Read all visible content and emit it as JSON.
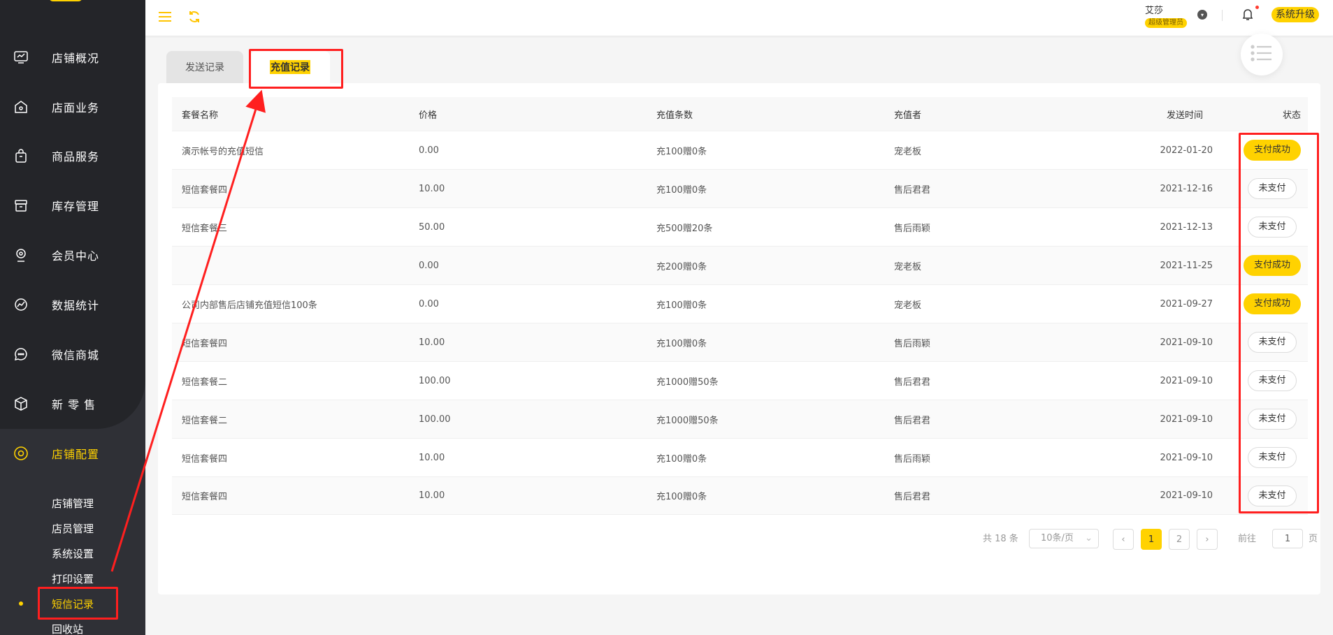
{
  "sidebar": {
    "menu": [
      {
        "label": "店铺概况",
        "icon": "monitor-icon"
      },
      {
        "label": "店面业务",
        "icon": "shop-icon"
      },
      {
        "label": "商品服务",
        "icon": "bag-icon"
      },
      {
        "label": "库存管理",
        "icon": "inventory-box-icon"
      },
      {
        "label": "会员中心",
        "icon": "member-icon"
      },
      {
        "label": "数据统计",
        "icon": "chart-trend-icon"
      },
      {
        "label": "微信商城",
        "icon": "chat-bubble-icon"
      },
      {
        "label": "新 零 售",
        "icon": "cube-icon"
      },
      {
        "label": "店铺配置",
        "icon": "settings-circle-icon"
      }
    ],
    "submenu": [
      "店铺管理",
      "店员管理",
      "系统设置",
      "打印设置",
      "短信记录",
      "回收站"
    ]
  },
  "header": {
    "user_name": "艾莎",
    "user_role": "超级管理员",
    "upgrade_label": "系统升级"
  },
  "tabs": {
    "send": "发送记录",
    "recharge": "充值记录"
  },
  "table": {
    "headers": [
      "套餐名称",
      "价格",
      "充值条数",
      "充值者",
      "发送时间",
      "状态"
    ],
    "rows": [
      {
        "name": "演示帐号的充值短信",
        "price": "0.00",
        "count": "充100赠0条",
        "user": "宠老板",
        "time": "2022-01-20",
        "status": "支付成功",
        "paid": true
      },
      {
        "name": "短信套餐四",
        "price": "10.00",
        "count": "充100赠0条",
        "user": "售后君君",
        "time": "2021-12-16",
        "status": "未支付",
        "paid": false
      },
      {
        "name": "短信套餐三",
        "price": "50.00",
        "count": "充500赠20条",
        "user": "售后雨颖",
        "time": "2021-12-13",
        "status": "未支付",
        "paid": false
      },
      {
        "name": "",
        "price": "0.00",
        "count": "充200赠0条",
        "user": "宠老板",
        "time": "2021-11-25",
        "status": "支付成功",
        "paid": true
      },
      {
        "name": "公司内部售后店铺充值短信100条",
        "price": "0.00",
        "count": "充100赠0条",
        "user": "宠老板",
        "time": "2021-09-27",
        "status": "支付成功",
        "paid": true
      },
      {
        "name": "短信套餐四",
        "price": "10.00",
        "count": "充100赠0条",
        "user": "售后雨颖",
        "time": "2021-09-10",
        "status": "未支付",
        "paid": false
      },
      {
        "name": "短信套餐二",
        "price": "100.00",
        "count": "充1000赠50条",
        "user": "售后君君",
        "time": "2021-09-10",
        "status": "未支付",
        "paid": false
      },
      {
        "name": "短信套餐二",
        "price": "100.00",
        "count": "充1000赠50条",
        "user": "售后君君",
        "time": "2021-09-10",
        "status": "未支付",
        "paid": false
      },
      {
        "name": "短信套餐四",
        "price": "10.00",
        "count": "充100赠0条",
        "user": "售后雨颖",
        "time": "2021-09-10",
        "status": "未支付",
        "paid": false
      },
      {
        "name": "短信套餐四",
        "price": "10.00",
        "count": "充100赠0条",
        "user": "售后君君",
        "time": "2021-09-10",
        "status": "未支付",
        "paid": false
      }
    ]
  },
  "pagination": {
    "total": "共 18 条",
    "page_size": "10条/页",
    "pages": [
      "1",
      "2"
    ],
    "current": "1",
    "goto_label": "前往",
    "goto_value": "1",
    "unit": "页"
  },
  "colors": {
    "accent": "#ffd200",
    "sidebar": "#2f3036",
    "annotation": "#ff1f1f"
  }
}
